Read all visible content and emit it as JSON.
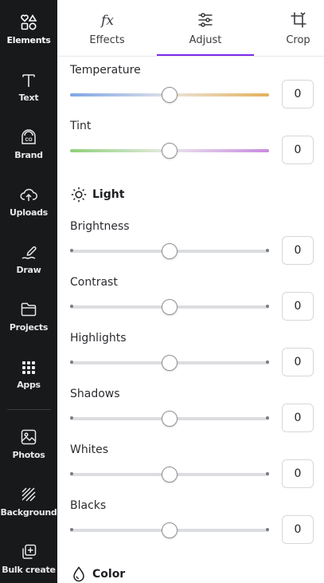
{
  "sidebar": {
    "items": [
      {
        "label": "Elements",
        "icon": "elements-icon",
        "active": true
      },
      {
        "label": "Text",
        "icon": "text-icon"
      },
      {
        "label": "Brand",
        "icon": "brand-icon"
      },
      {
        "label": "Uploads",
        "icon": "uploads-icon"
      },
      {
        "label": "Draw",
        "icon": "draw-icon"
      },
      {
        "label": "Projects",
        "icon": "projects-icon"
      },
      {
        "label": "Apps",
        "icon": "apps-icon"
      },
      {
        "label": "Photos",
        "icon": "photos-icon"
      },
      {
        "label": "Background",
        "icon": "background-icon"
      },
      {
        "label": "Bulk create",
        "icon": "bulk-create-icon"
      }
    ]
  },
  "tabs": [
    {
      "label": "Effects",
      "icon": "effects-icon"
    },
    {
      "label": "Adjust",
      "icon": "adjust-icon",
      "active": true
    },
    {
      "label": "Crop",
      "icon": "crop-icon"
    }
  ],
  "accent_color": "#7d2ae8",
  "white_balance": {
    "temperature": {
      "label": "Temperature",
      "value": "0",
      "level": 0.5
    },
    "tint": {
      "label": "Tint",
      "value": "0",
      "level": 0.5
    }
  },
  "light": {
    "title": "Light",
    "icon": "sun-icon",
    "sliders": [
      {
        "label": "Brightness",
        "value": "0",
        "level": 0.5
      },
      {
        "label": "Contrast",
        "value": "0",
        "level": 0.5
      },
      {
        "label": "Highlights",
        "value": "0",
        "level": 0.5
      },
      {
        "label": "Shadows",
        "value": "0",
        "level": 0.5
      },
      {
        "label": "Whites",
        "value": "0",
        "level": 0.5
      },
      {
        "label": "Blacks",
        "value": "0",
        "level": 0.5
      }
    ]
  },
  "color": {
    "title": "Color",
    "icon": "color-drop-icon"
  }
}
